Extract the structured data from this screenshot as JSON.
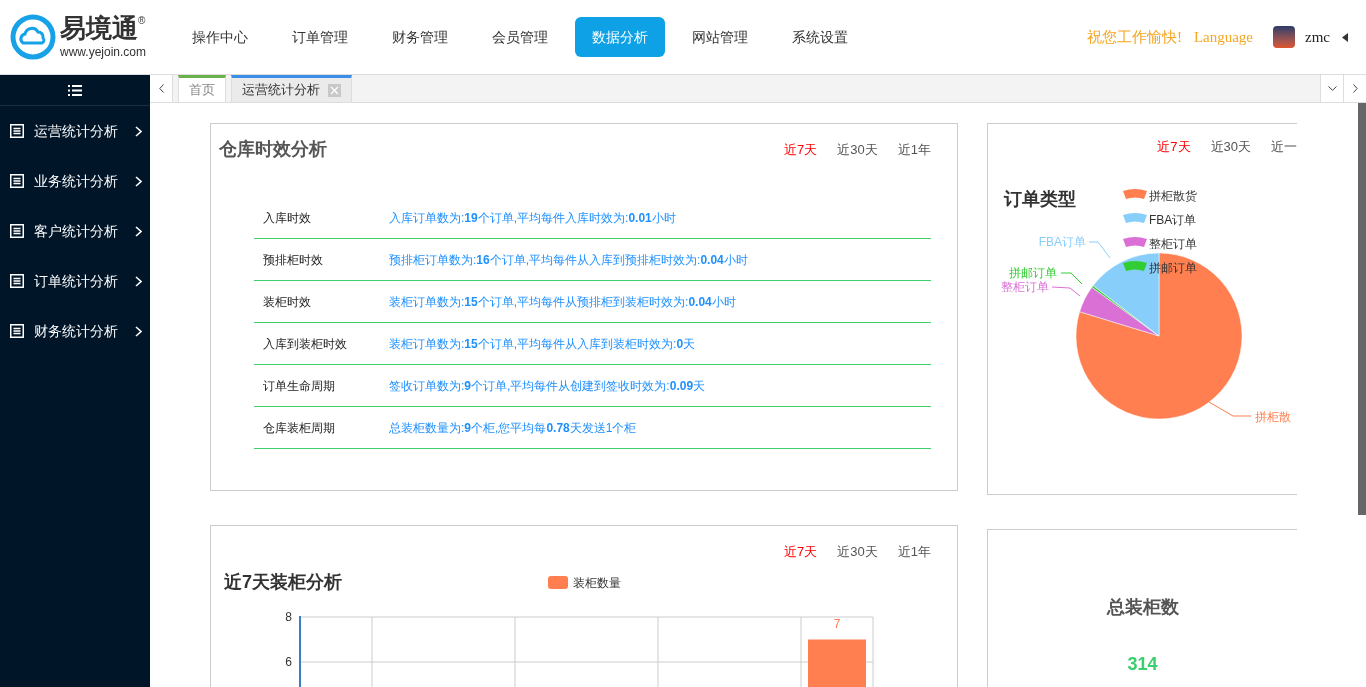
{
  "header": {
    "logo": {
      "name": "易境通",
      "mark": "®",
      "url": "www.yejoin.com"
    },
    "nav": [
      {
        "label": "操作中心",
        "selected": false
      },
      {
        "label": "订单管理",
        "selected": false
      },
      {
        "label": "财务管理",
        "selected": false
      },
      {
        "label": "会员管理",
        "selected": false
      },
      {
        "label": "数据分析",
        "selected": true
      },
      {
        "label": "网站管理",
        "selected": false
      },
      {
        "label": "系统设置",
        "selected": false
      }
    ],
    "greeting": "祝您工作愉快!",
    "language": "Language",
    "user": "zmc"
  },
  "sidebar": {
    "items": [
      "运营统计分析",
      "业务统计分析",
      "客户统计分析",
      "订单统计分析",
      "财务统计分析"
    ]
  },
  "tabs": [
    {
      "label": "首页",
      "selected": false,
      "closable": false
    },
    {
      "label": "运营统计分析",
      "selected": true,
      "closable": true
    }
  ],
  "warehouse_card": {
    "title": "仓库时效分析",
    "periods": [
      {
        "label": "近7天",
        "selected": true
      },
      {
        "label": "近30天",
        "selected": false
      },
      {
        "label": "近1年",
        "selected": false
      }
    ],
    "rows": [
      {
        "label": "入库时效",
        "description": "入库订单数为:**19**个订单,平均每件入库时效为:**0.01**小时"
      },
      {
        "label": "预排柜时效",
        "description": "预排柜订单数为:**16**个订单,平均每件从入库到预排柜时效为:**0.04**小时"
      },
      {
        "label": "装柜时效",
        "description": "装柜订单数为:**15**个订单,平均每件从预排柜到装柜时效为:**0.04**小时"
      },
      {
        "label": "入库到装柜时效",
        "description": "装柜订单数为:**15**个订单,平均每件从入库到装柜时效为:**0**天"
      },
      {
        "label": "订单生命周期",
        "description": "签收订单数为:**9**个订单,平均每件从创建到签收时效为:**0.09**天"
      },
      {
        "label": "仓库装柜周期",
        "description": "总装柜数量为:**9**个柜,您平均每**0.78**天发送1个柜"
      }
    ]
  },
  "order_type_card": {
    "periods": [
      {
        "label": "近7天",
        "selected": true
      },
      {
        "label": "近30天",
        "selected": false
      },
      {
        "label": "近一",
        "selected": false
      }
    ],
    "title": "订单类型",
    "legend": [
      {
        "label": "拼柜散货",
        "color": "#ff7f50"
      },
      {
        "label": "FBA订单",
        "color": "#87cefa"
      },
      {
        "label": "整柜订单",
        "color": "#da70d6"
      },
      {
        "label": "拼邮订单",
        "color": "#32cd32"
      }
    ],
    "slice_labels": [
      {
        "label": "拼柜散",
        "color": "#ff7f50"
      },
      {
        "label": "整柜订单",
        "color": "#da70d6"
      },
      {
        "label": "拼邮订单",
        "color": "#32cd32"
      },
      {
        "label": "FBA订单",
        "color": "#87cefa"
      }
    ]
  },
  "loading_card": {
    "title": "近7天装柜分析",
    "periods": [
      {
        "label": "近7天",
        "selected": true
      },
      {
        "label": "近30天",
        "selected": false
      },
      {
        "label": "近1年",
        "selected": false
      }
    ],
    "chart_data": {
      "type": "bar",
      "series": [
        {
          "name": "装柜数量",
          "color": "#ff7f50",
          "values": [
            null,
            null,
            null,
            null,
            7
          ]
        }
      ],
      "yticks": [
        6,
        8
      ],
      "ylim": [
        0,
        8
      ],
      "data_labels": true
    }
  },
  "total_card": {
    "title": "总装柜数",
    "value": "314"
  }
}
